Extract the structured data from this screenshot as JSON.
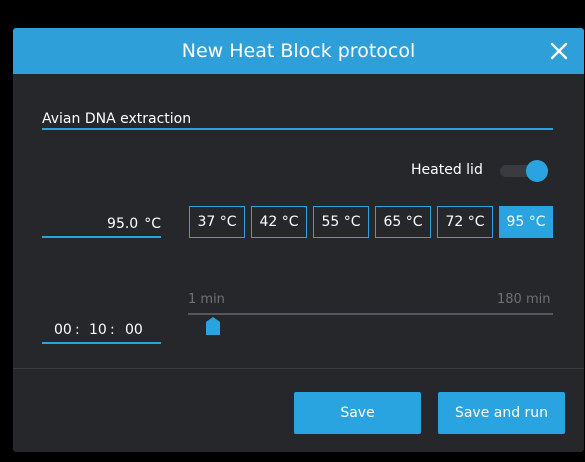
{
  "dialog": {
    "title": "New Heat Block protocol",
    "close_icon": "close-icon"
  },
  "protocol_name": {
    "value": "Avian DNA extraction"
  },
  "heated_lid": {
    "label": "Heated lid",
    "enabled": true
  },
  "temperature": {
    "value": "95.0",
    "unit": "°C",
    "presets": [
      "37 °C",
      "42 °C",
      "55 °C",
      "65 °C",
      "72 °C",
      "95 °C"
    ],
    "selected_preset": "95 °C"
  },
  "duration": {
    "hours": "00",
    "minutes": "10",
    "seconds": "00",
    "separator": ":",
    "slider_min_label": "1 min",
    "slider_max_label": "180 min"
  },
  "actions": {
    "save_label": "Save",
    "save_and_run_label": "Save and run"
  },
  "colors": {
    "accent": "#2aa4e0",
    "title_bar": "#2f9fd9",
    "dialog_background": "#26272b"
  }
}
